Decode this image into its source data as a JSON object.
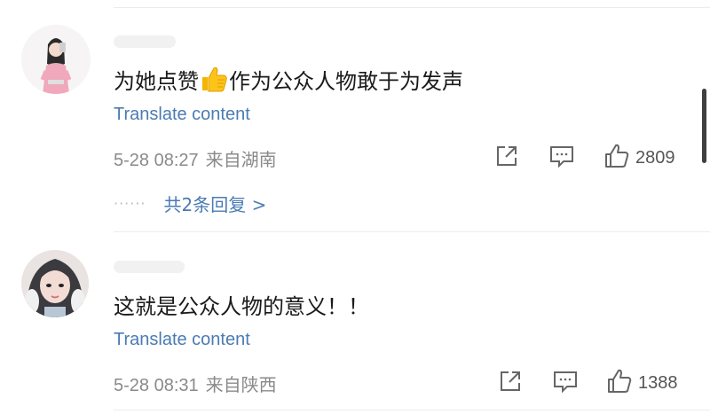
{
  "comments": [
    {
      "text_before": "为她点赞",
      "emoji": "thumbs-up-emoji",
      "text_after": "作为公众人物敢于为发声",
      "translate": "Translate content",
      "time": "5-28 08:27",
      "location": "来自湖南",
      "likes": "2809",
      "replies_label": "共2条回复 >"
    },
    {
      "text": "这就是公众人物的意义！！",
      "translate": "Translate content",
      "time": "5-28 08:31",
      "location": "来自陕西",
      "likes": "1388"
    }
  ],
  "colors": {
    "link": "#4a7bb3",
    "meta": "#8a8a8a",
    "divider": "#ececec"
  }
}
